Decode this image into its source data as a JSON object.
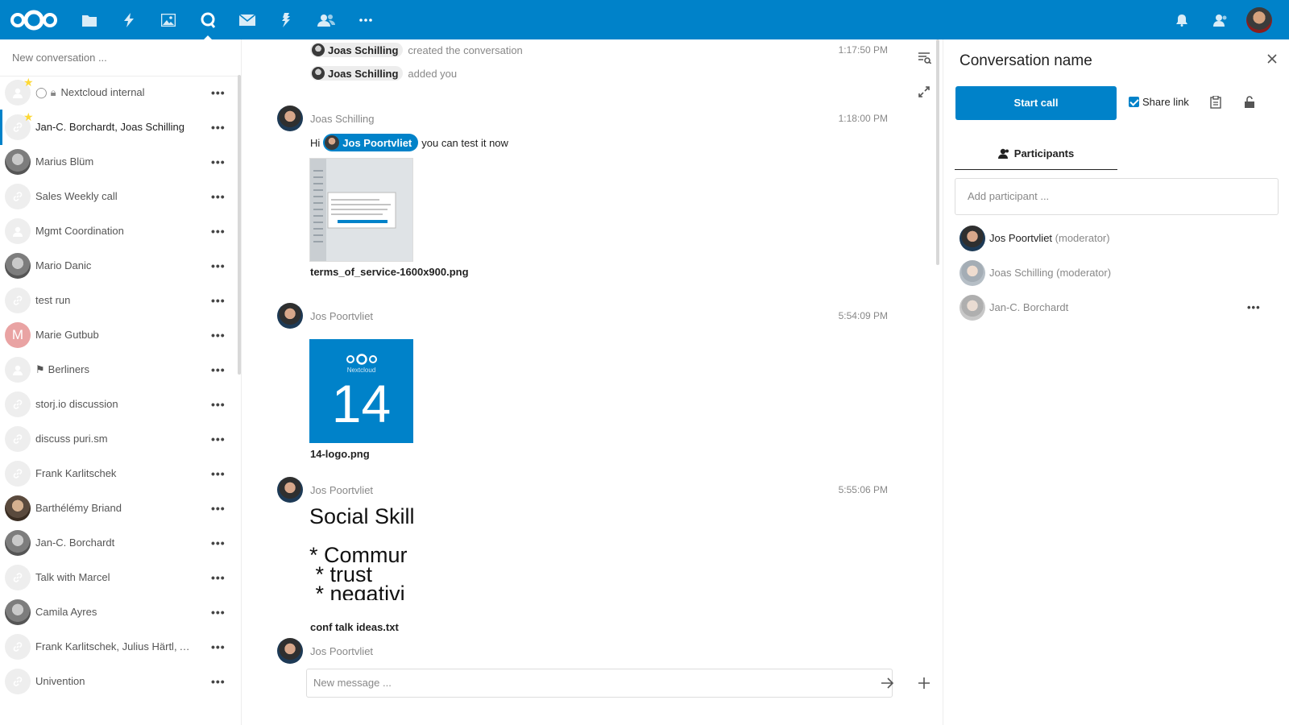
{
  "header": {
    "apps": [
      {
        "icon": "files-icon"
      },
      {
        "icon": "activity-icon"
      },
      {
        "icon": "gallery-icon"
      },
      {
        "icon": "talk-icon",
        "active": true
      },
      {
        "icon": "mail-icon"
      },
      {
        "icon": "deck-icon"
      },
      {
        "icon": "contacts-icon"
      },
      {
        "icon": "more-apps-icon"
      }
    ],
    "right_icons": [
      "notifications-icon",
      "contacts-menu-icon",
      "user-avatar"
    ],
    "colors": {
      "primary": "#0082c9"
    }
  },
  "sidebar": {
    "new_conversation_placeholder": "New conversation ...",
    "conversations": [
      {
        "name": "Nextcloud internal",
        "favorite": true,
        "avatar": "group"
      },
      {
        "name": "Jan-C. Borchardt, Joas Schilling",
        "favorite": true,
        "avatar": "link",
        "active": true
      },
      {
        "name": "Marius Blüm",
        "avatar": "photo"
      },
      {
        "name": "Sales Weekly call",
        "avatar": "link"
      },
      {
        "name": "Mgmt Coordination",
        "avatar": "group"
      },
      {
        "name": "Mario Danic",
        "avatar": "photo"
      },
      {
        "name": "test run",
        "avatar": "link"
      },
      {
        "name": "Marie Gutbub",
        "avatar": "letter",
        "letter": "M"
      },
      {
        "name": "Berliners",
        "avatar": "group",
        "flag": true
      },
      {
        "name": "storj.io discussion",
        "avatar": "link"
      },
      {
        "name": "discuss puri.sm",
        "avatar": "link"
      },
      {
        "name": "Frank Karlitschek",
        "avatar": "link"
      },
      {
        "name": "Barthélémy Briand",
        "avatar": "photo2"
      },
      {
        "name": "Jan-C. Borchardt",
        "avatar": "photo"
      },
      {
        "name": "Talk with Marcel",
        "avatar": "link"
      },
      {
        "name": "Camila Ayres",
        "avatar": "photo"
      },
      {
        "name": "Frank Karlitschek, Julius Härtl, Ar...",
        "avatar": "link"
      },
      {
        "name": "Univention",
        "avatar": "link"
      }
    ],
    "more_label": "•••"
  },
  "chat": {
    "system_messages": [
      {
        "actor": "Joas Schilling",
        "text": "created the conversation",
        "time": "1:17:50 PM"
      },
      {
        "actor": "Joas Schilling",
        "text": "added you",
        "time": ""
      }
    ],
    "messages": [
      {
        "author": "Joas Schilling",
        "time": "1:18:00 PM",
        "text_before": "Hi",
        "mention": "Jos Poortvliet",
        "text_after": "you can test it now",
        "file": "terms_of_service-1600x900.png"
      },
      {
        "author": "Jos Poortvliet",
        "time": "5:54:09 PM",
        "file": "14-logo.png",
        "logo_text": "Nextcloud",
        "logo_number": "14"
      },
      {
        "author": "Jos Poortvliet",
        "time": "5:55:06 PM",
        "file": "conf talk ideas.txt",
        "preview_lines": [
          "Social Skill",
          "* Commur",
          " * trust",
          " * negativi"
        ]
      },
      {
        "author": "Jos Poortvliet",
        "time": ""
      }
    ],
    "input_placeholder": "New message ..."
  },
  "panel": {
    "title": "Conversation name",
    "start_call": "Start call",
    "share_link_label": "Share link",
    "share_link_checked": true,
    "tab_participants": "Participants",
    "add_participant_placeholder": "Add participant ...",
    "participants": [
      {
        "name": "Jos Poortvliet",
        "role": "(moderator)"
      },
      {
        "name": "Joas Schilling",
        "role": "(moderator)"
      },
      {
        "name": "Jan-C. Borchardt",
        "role": ""
      }
    ]
  }
}
